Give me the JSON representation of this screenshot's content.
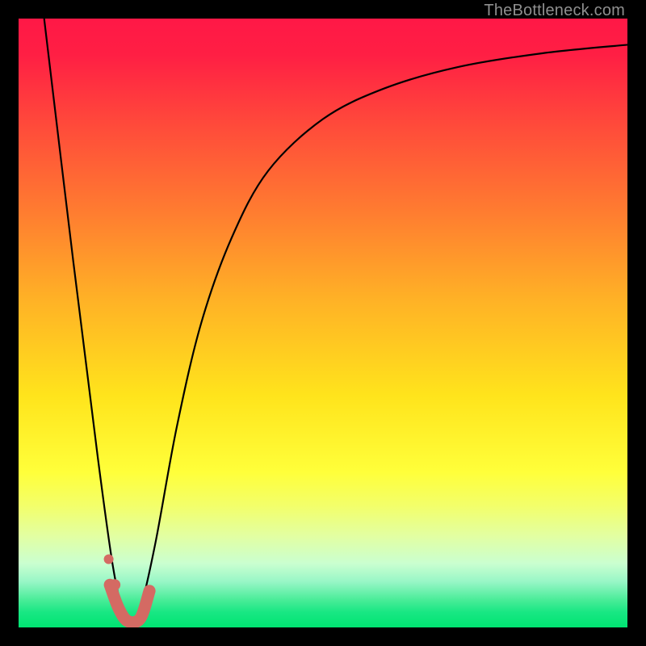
{
  "watermark": "TheBottleneck.com",
  "chart_data": {
    "type": "line",
    "title": "",
    "xlabel": "",
    "ylabel": "",
    "xlim": [
      0,
      100
    ],
    "ylim": [
      0,
      100
    ],
    "gradient_stops": [
      {
        "pos": 0.0,
        "color": "#ff1846"
      },
      {
        "pos": 0.06,
        "color": "#ff1f44"
      },
      {
        "pos": 0.18,
        "color": "#ff4c3a"
      },
      {
        "pos": 0.32,
        "color": "#ff7d30"
      },
      {
        "pos": 0.46,
        "color": "#ffb126"
      },
      {
        "pos": 0.62,
        "color": "#ffe41c"
      },
      {
        "pos": 0.745,
        "color": "#ffff3a"
      },
      {
        "pos": 0.8,
        "color": "#f3ff6a"
      },
      {
        "pos": 0.85,
        "color": "#e2ffa2"
      },
      {
        "pos": 0.895,
        "color": "#caffd0"
      },
      {
        "pos": 0.925,
        "color": "#97f6c6"
      },
      {
        "pos": 0.955,
        "color": "#49e c98"
      },
      {
        "pos": 0.975,
        "color": "#18e783"
      },
      {
        "pos": 1.0,
        "color": "#00e472"
      }
    ],
    "series": [
      {
        "name": "bottleneck-curve",
        "stroke": "#000000",
        "stroke_width": 2.2,
        "points": [
          {
            "x": 4.2,
            "y": 100.0
          },
          {
            "x": 9.0,
            "y": 60.0
          },
          {
            "x": 13.0,
            "y": 28.0
          },
          {
            "x": 15.5,
            "y": 10.0
          },
          {
            "x": 17.3,
            "y": 2.0
          },
          {
            "x": 18.6,
            "y": 0.5
          },
          {
            "x": 20.0,
            "y": 3.0
          },
          {
            "x": 22.5,
            "y": 14.0
          },
          {
            "x": 26.0,
            "y": 33.0
          },
          {
            "x": 30.0,
            "y": 50.0
          },
          {
            "x": 35.0,
            "y": 64.0
          },
          {
            "x": 41.0,
            "y": 75.0
          },
          {
            "x": 50.0,
            "y": 83.5
          },
          {
            "x": 60.0,
            "y": 88.5
          },
          {
            "x": 72.0,
            "y": 92.0
          },
          {
            "x": 86.0,
            "y": 94.3
          },
          {
            "x": 100.0,
            "y": 95.7
          }
        ]
      },
      {
        "name": "highlight-sweet-spot",
        "stroke": "#d46a63",
        "stroke_width": 15,
        "cap": "round",
        "points": [
          {
            "x": 15.0,
            "y": 7.0
          },
          {
            "x": 16.5,
            "y": 3.0
          },
          {
            "x": 18.0,
            "y": 1.0
          },
          {
            "x": 20.0,
            "y": 1.5
          },
          {
            "x": 21.5,
            "y": 6.0
          }
        ]
      },
      {
        "name": "marker-dot-1",
        "type": "point",
        "fill": "#d46a63",
        "r": 6,
        "points": [
          {
            "x": 14.8,
            "y": 11.2
          }
        ]
      },
      {
        "name": "marker-dot-2",
        "type": "point",
        "fill": "#d46a63",
        "r": 7,
        "points": [
          {
            "x": 15.8,
            "y": 7.0
          }
        ]
      }
    ]
  }
}
